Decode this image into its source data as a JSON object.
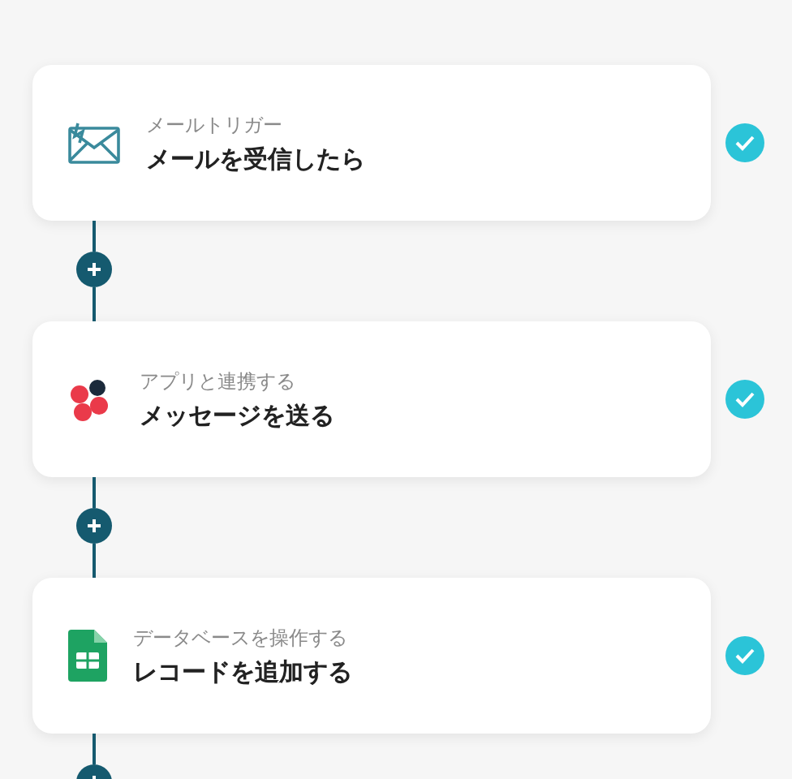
{
  "steps": [
    {
      "kind": "mail",
      "category": "メールトリガー",
      "title": "メールを受信したら",
      "checked": true
    },
    {
      "kind": "app",
      "category": "アプリと連携する",
      "title": "メッセージを送る",
      "checked": true
    },
    {
      "kind": "sheet",
      "category": "データベースを操作する",
      "title": "レコードを追加する",
      "checked": true
    }
  ]
}
